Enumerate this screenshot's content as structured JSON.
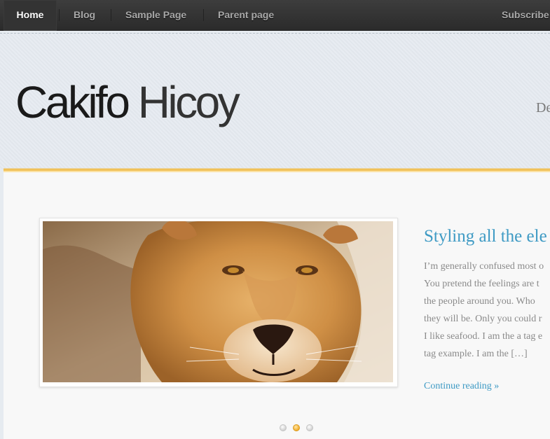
{
  "nav": {
    "items": [
      {
        "label": "Home",
        "active": true
      },
      {
        "label": "Blog",
        "active": false
      },
      {
        "label": "Sample Page",
        "active": false
      },
      {
        "label": "Parent page",
        "active": false
      }
    ],
    "subscribe_label": "Subscribe I"
  },
  "header": {
    "site_title_part1": "Cakifo",
    "site_title_part2": "Hicoy",
    "description_fragment": "De"
  },
  "slider": {
    "image_icon": "lioness-photo",
    "post_title": "Styling all the ele",
    "excerpt_lines": [
      "I’m generally confused most o",
      "You pretend the feelings are t",
      "the people around you. Who",
      "they will be. Only you could r",
      "I like seafood. I am the a tag e",
      "tag example. I am the […]"
    ],
    "continue_label": "Continue reading »",
    "dots": [
      {
        "active": false
      },
      {
        "active": true
      },
      {
        "active": false
      }
    ]
  },
  "colors": {
    "accent_link": "#3e9ac4",
    "accent_border": "#f1c25a",
    "nav_background": "#2e2e2e"
  }
}
